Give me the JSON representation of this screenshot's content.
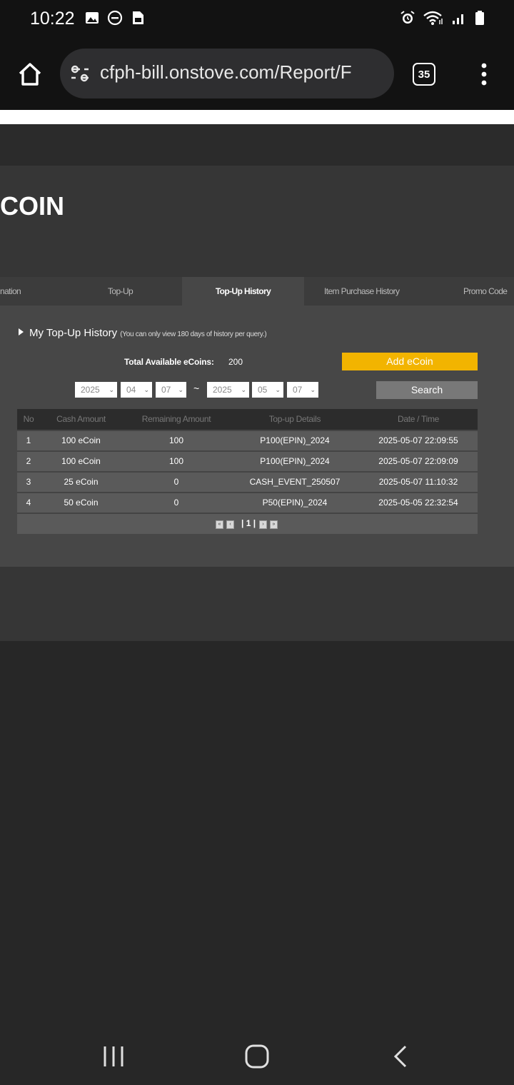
{
  "status_bar": {
    "time": "10:22",
    "left_icons": [
      "image-icon",
      "do-not-disturb-icon",
      "sim-card-icon"
    ],
    "right_icons": [
      "alarm-icon",
      "wifi-icon",
      "signal-icon",
      "battery-icon"
    ]
  },
  "browser": {
    "url": "cfph-bill.onstove.com/Report/F",
    "tab_count": "35"
  },
  "page": {
    "title": "COIN",
    "tabs": [
      {
        "label": "nation",
        "active": false
      },
      {
        "label": "Top-Up",
        "active": false
      },
      {
        "label": "Top-Up History",
        "active": true
      },
      {
        "label": "Item Purchase History",
        "active": false
      },
      {
        "label": "Promo Code",
        "active": false
      }
    ],
    "section_heading": "My Top-Up History",
    "section_note": "(You can only view 180 days of history per query.)",
    "total_label": "Total Available eCoins:",
    "total_value": "200",
    "add_button": "Add eCoin",
    "search_button": "Search",
    "date_from": {
      "year": "2025",
      "month": "04",
      "day": "07"
    },
    "date_separator": "~",
    "date_to": {
      "year": "2025",
      "month": "05",
      "day": "07"
    },
    "table": {
      "headers": [
        "No",
        "Cash Amount",
        "Remaining Amount",
        "Top-up Details",
        "Date / Time"
      ],
      "rows": [
        [
          "1",
          "100 eCoin",
          "100",
          "P100(EPIN)_2024",
          "2025-05-07 22:09:55"
        ],
        [
          "2",
          "100 eCoin",
          "100",
          "P100(EPIN)_2024",
          "2025-05-07 22:09:09"
        ],
        [
          "3",
          "25 eCoin",
          "0",
          "CASH_EVENT_250507",
          "2025-05-07 11:10:32"
        ],
        [
          "4",
          "50 eCoin",
          "0",
          "P50(EPIN)_2024",
          "2025-05-05 22:32:54"
        ]
      ]
    },
    "pagination": {
      "current": "| 1 |"
    }
  },
  "colors": {
    "accent": "#f2b400",
    "background": "#272727",
    "panel": "#474747"
  }
}
